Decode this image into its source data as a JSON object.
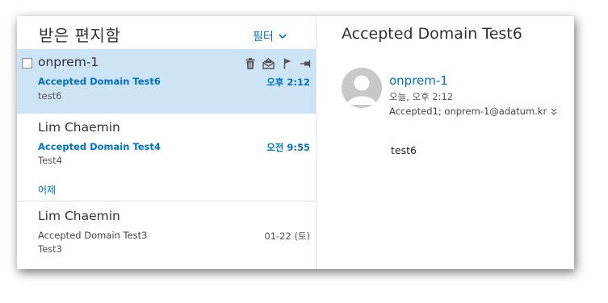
{
  "list": {
    "folder_title": "받은 편지함",
    "filter_label": "필터",
    "messages": [
      {
        "sender": "onprem-1",
        "subject": "Accepted Domain Test6",
        "preview": "test6",
        "time": "오후 2:12"
      },
      {
        "sender": "Lim Chaemin",
        "subject": "Accepted Domain Test4",
        "preview": "Test4",
        "time": "오전 9:55"
      },
      {
        "sender": "Lim Chaemin",
        "subject": "Accepted Domain Test3",
        "preview": "Test3",
        "time": "01-22 (토)"
      }
    ],
    "group_yesterday": "어제"
  },
  "reading": {
    "subject": "Accepted Domain Test6",
    "from": "onprem-1",
    "date": "오늘, 오후 2:12",
    "recipients": "Accepted1; onprem-1@adatum.kr",
    "body": "test6"
  },
  "icons": {
    "delete": "trash-icon",
    "read_toggle": "envelope-open-icon",
    "flag": "flag-icon",
    "pin": "pin-icon",
    "filter_chevron": "chevron-down-icon",
    "expand": "double-chevron-down-icon"
  },
  "colors": {
    "accent": "#0072c6",
    "selected_bg": "#cde4f6"
  }
}
